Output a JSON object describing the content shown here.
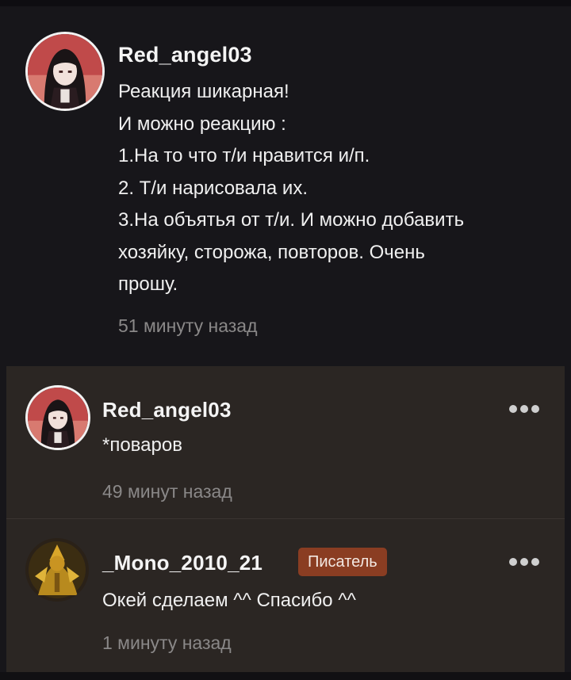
{
  "main_comment": {
    "username": "Red_angel03",
    "text": "Реакция шикарная!\nИ можно реакцию :\n1.На то что т/и нравится и/п.\n2. Т/и нарисовала их.\n3.На объятья от т/и. И можно добавить\nхозяйку, сторожа, повторов. Очень\nпрошу.",
    "time": "51 минуту назад",
    "avatar_icon": "anime-girl-avatar-icon"
  },
  "replies": [
    {
      "username": "Red_angel03",
      "text": "*поваров",
      "time": "49 минут назад",
      "avatar_icon": "anime-girl-avatar-icon"
    },
    {
      "username": "_Mono_2010_21",
      "badge": "Писатель",
      "text": "Окей сделаем ^^ Спасибо ^^",
      "time": "1 минуту назад",
      "avatar_icon": "golden-character-avatar-icon"
    }
  ],
  "colors": {
    "background": "#17161a",
    "reply_background": "#2b2623",
    "badge": "#8a3d22",
    "timestamp": "#8a8888"
  }
}
